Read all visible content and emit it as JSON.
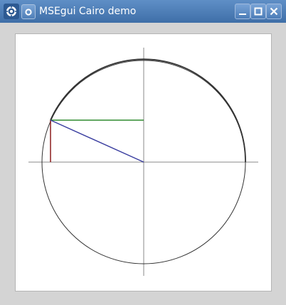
{
  "window": {
    "title": "MSEgui Cairo demo",
    "icons": {
      "app": "gear-icon",
      "menu": "ring-icon",
      "minimize": "minimize-icon",
      "maximize": "maximize-icon",
      "close": "close-icon"
    }
  },
  "drawing": {
    "colors": {
      "axes": "#888888",
      "circle": "#333333",
      "radius": "#3b3fa0",
      "sine": "#8b1a1a",
      "cosine": "#2e8b2e"
    }
  }
}
